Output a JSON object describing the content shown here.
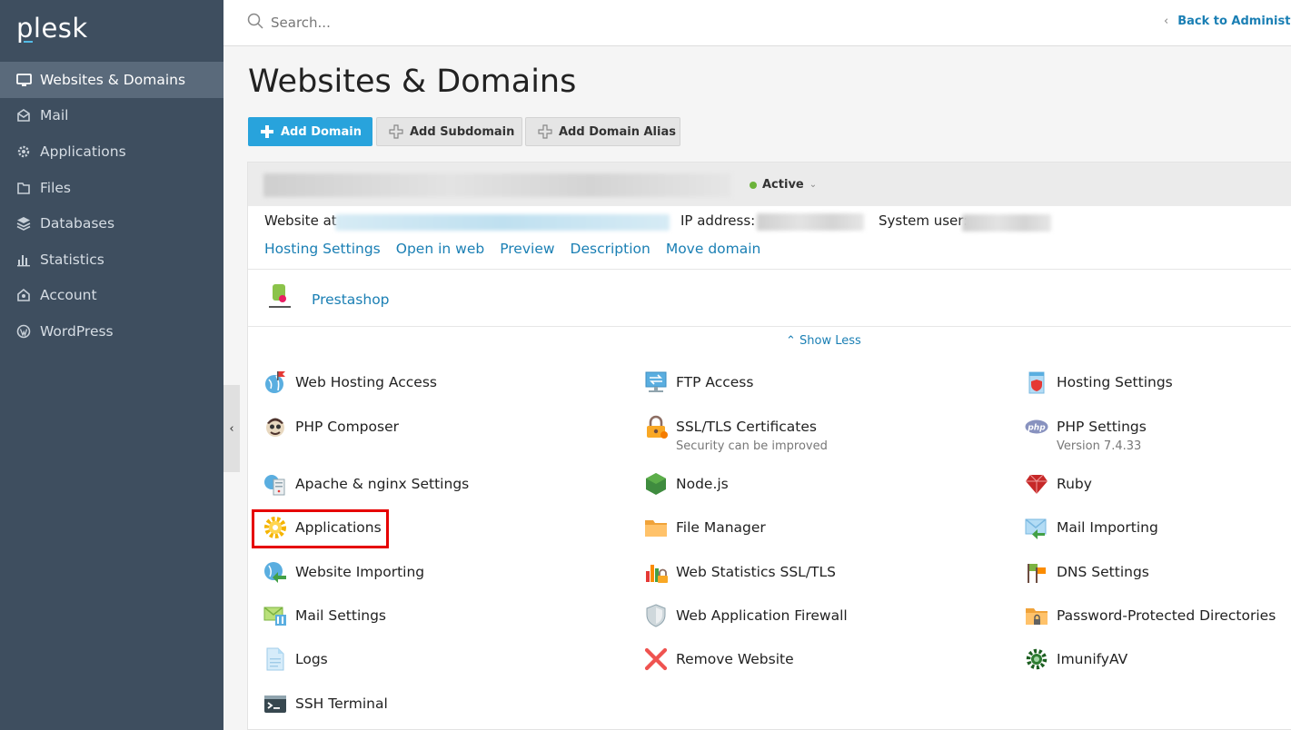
{
  "brand": {
    "logo_text": "plesk"
  },
  "sidebar": {
    "items": [
      {
        "label": "Websites & Domains",
        "icon": "monitor-icon",
        "active": true
      },
      {
        "label": "Mail",
        "icon": "envelope-icon"
      },
      {
        "label": "Applications",
        "icon": "gear-icon"
      },
      {
        "label": "Files",
        "icon": "folder-icon"
      },
      {
        "label": "Databases",
        "icon": "database-icon"
      },
      {
        "label": "Statistics",
        "icon": "bar-chart-icon"
      },
      {
        "label": "Account",
        "icon": "account-icon"
      },
      {
        "label": "WordPress",
        "icon": "wordpress-icon"
      }
    ]
  },
  "header": {
    "search_placeholder": "Search...",
    "back_link": "Back to Administrat"
  },
  "page": {
    "title": "Websites & Domains",
    "buttons": {
      "add_domain": "Add Domain",
      "add_subdomain": "Add Subdomain",
      "add_alias": "Add Domain Alias"
    }
  },
  "domain": {
    "status": "Active",
    "website_at_label": "Website at",
    "ip_label": "IP address:",
    "system_user_label": "System user:",
    "links": [
      "Hosting Settings",
      "Open in web",
      "Preview",
      "Description",
      "Move domain"
    ],
    "app_name": "Prestashop",
    "show_less": "Show Less"
  },
  "tools": {
    "col1": [
      {
        "label": "Web Hosting Access",
        "icon": "globe-flag-icon"
      },
      {
        "label": "PHP Composer",
        "icon": "composer-icon"
      },
      {
        "label": "Apache & nginx Settings",
        "icon": "server-globe-icon"
      },
      {
        "label": "Applications",
        "icon": "gear-icon"
      },
      {
        "label": "Website Importing",
        "icon": "globe-arrow-icon"
      },
      {
        "label": "Mail Settings",
        "icon": "mail-settings-icon"
      },
      {
        "label": "Logs",
        "icon": "document-icon"
      },
      {
        "label": "SSH Terminal",
        "icon": "terminal-icon"
      }
    ],
    "col2": [
      {
        "label": "FTP Access",
        "icon": "ftp-icon"
      },
      {
        "label": "SSL/TLS Certificates",
        "sub": "Security can be improved",
        "icon": "lock-icon"
      },
      {
        "label": "Node.js",
        "icon": "nodejs-icon"
      },
      {
        "label": "File Manager",
        "icon": "folder-icon"
      },
      {
        "label": "Web Statistics SSL/TLS",
        "icon": "stats-lock-icon"
      },
      {
        "label": "Web Application Firewall",
        "icon": "shield-icon"
      },
      {
        "label": "Remove Website",
        "icon": "remove-x-icon"
      }
    ],
    "col3": [
      {
        "label": "Hosting Settings",
        "icon": "hosting-settings-icon"
      },
      {
        "label": "PHP Settings",
        "sub": "Version 7.4.33",
        "icon": "php-icon"
      },
      {
        "label": "Ruby",
        "icon": "ruby-icon"
      },
      {
        "label": "Mail Importing",
        "icon": "mail-import-icon"
      },
      {
        "label": "DNS Settings",
        "icon": "dns-icon"
      },
      {
        "label": "Password-Protected Directories",
        "icon": "protected-folder-icon"
      },
      {
        "label": "ImunifyAV",
        "icon": "imunify-icon"
      }
    ]
  },
  "colors": {
    "sidebar_bg": "#3e4e5f",
    "accent": "#28a3dc",
    "link": "#1a7fb4",
    "highlight": "#e60000",
    "active_status": "#6bb33a"
  }
}
